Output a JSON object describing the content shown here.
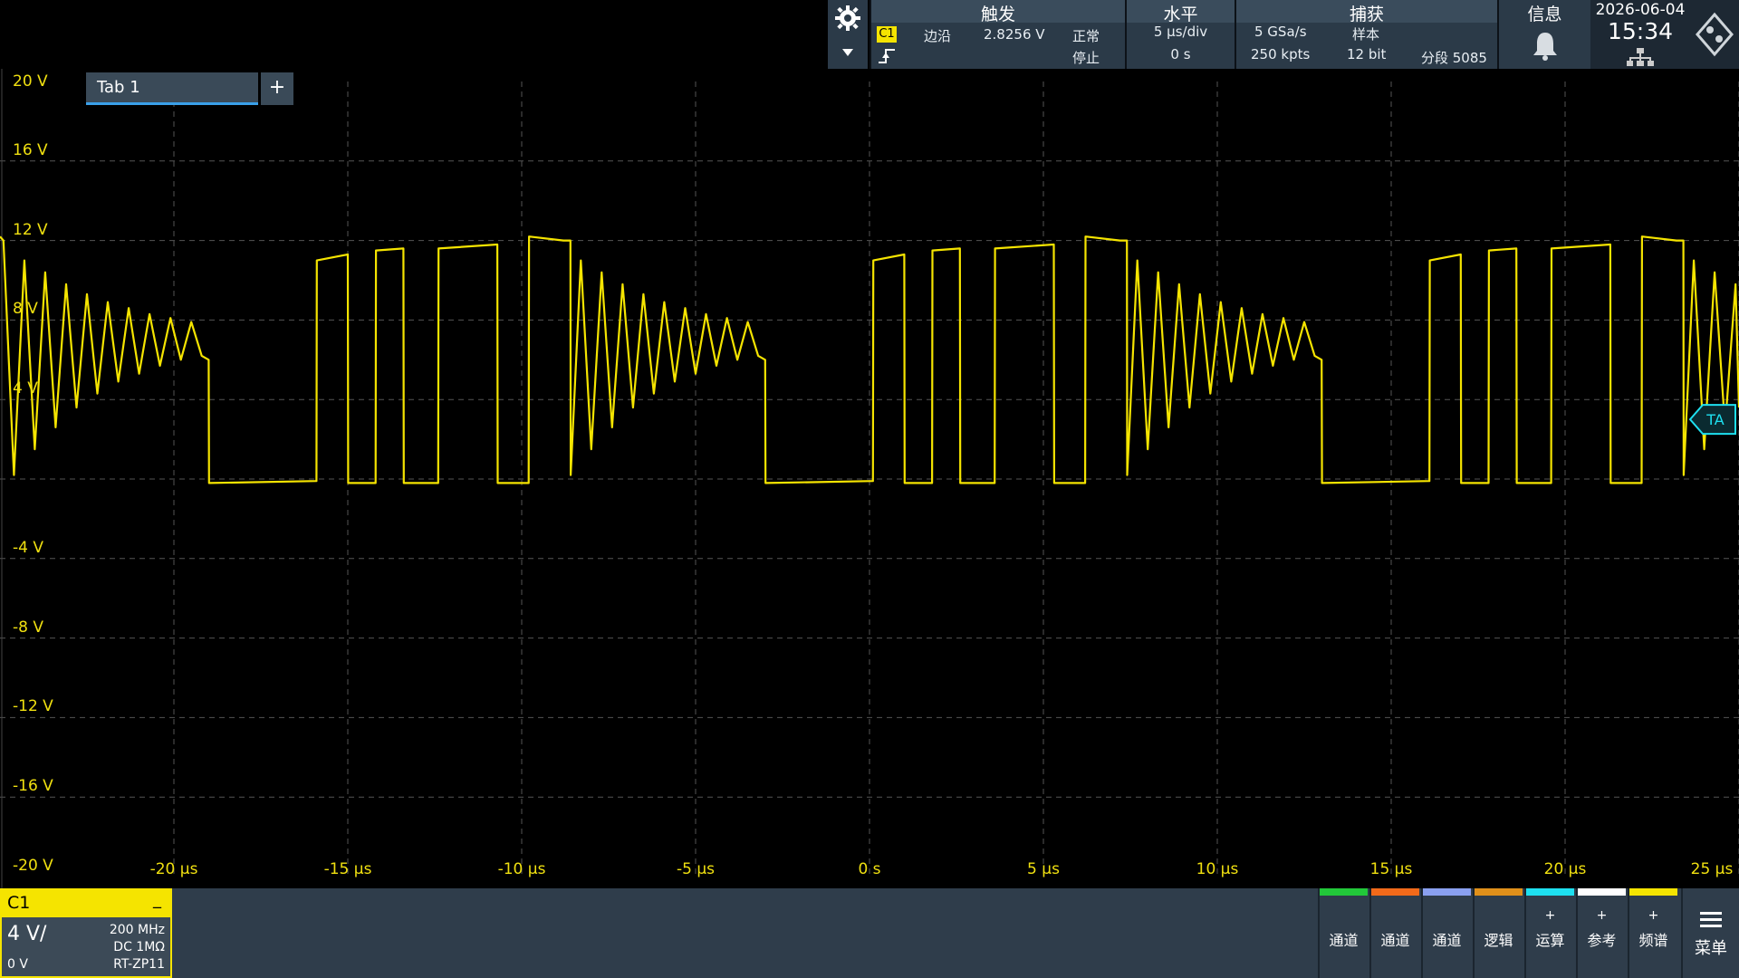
{
  "topbar": {
    "trigger": {
      "title": "触发",
      "channel": "C1",
      "type": "边沿",
      "level": "2.8256 V",
      "mode": "正常",
      "state": "停止"
    },
    "horizontal": {
      "title": "水平",
      "scale": "5 µs/div",
      "position": "0 s"
    },
    "acquisition": {
      "title": "捕获",
      "sample_rate": "5 GSa/s",
      "mode": "样本",
      "record_length": "250 kpts",
      "resolution": "12 bit",
      "segment": "分段 5085"
    },
    "info": {
      "title": "信息"
    },
    "date": "2026-06-04",
    "time": "15:34",
    "icons": {
      "settings": "gear-icon",
      "dropdown": "chevron-down-icon",
      "edge": "rising-edge-icon",
      "bell": "bell-icon",
      "network": "network-icon",
      "logo": "rs-logo"
    }
  },
  "tab": {
    "label": "Tab 1",
    "add": "+"
  },
  "chart_data": {
    "type": "line",
    "title": "",
    "xlabel": "",
    "ylabel": "",
    "y_ticks": [
      "20 V",
      "16 V",
      "12 V",
      "8 V",
      "4 V",
      "",
      "-4 V",
      "-8 V",
      "-12 V",
      "-16 V",
      "-20 V"
    ],
    "x_ticks": [
      "-20 µs",
      "-15 µs",
      "-10 µs",
      "-5 µs",
      "0 s",
      "5 µs",
      "10 µs",
      "15 µs",
      "20 µs",
      "25 µs"
    ],
    "xlim": [
      -25,
      25
    ],
    "ylim": [
      -20,
      20
    ],
    "grid": true,
    "series": [
      {
        "color": "#f5e400",
        "x": [
          -25,
          -24.9,
          -24.6,
          -24.3,
          -24.0,
          -23.7,
          -23.4,
          -23.1,
          -22.8,
          -22.5,
          -22.2,
          -21.9,
          -21.6,
          -21.3,
          -21.0,
          -20.7,
          -20.4,
          -20.1,
          -19.8,
          -19.5,
          -19.2,
          -19.0,
          -18.99,
          -15.9,
          -15.89,
          -15.0,
          -14.99,
          -14.2,
          -14.19,
          -13.4,
          -13.39,
          -12.4,
          -12.39,
          -10.7,
          -10.69,
          -9.8,
          -9.79,
          -8.8,
          -8.6,
          -8.59,
          -8.3,
          -8.0,
          -7.7,
          -7.4,
          -7.1,
          -6.8,
          -6.5,
          -6.2,
          -5.9,
          -5.6,
          -5.3,
          -5.0,
          -4.7,
          -4.4,
          -4.1,
          -3.8,
          -3.5,
          -3.2,
          -3.0,
          -2.99,
          0.1,
          0.11,
          1.0,
          1.01,
          1.8,
          1.81,
          2.6,
          2.61,
          3.6,
          3.61,
          5.3,
          5.31,
          6.2,
          6.21,
          7.2,
          7.4,
          7.41,
          7.7,
          8.0,
          8.3,
          8.6,
          8.9,
          9.2,
          9.5,
          9.8,
          10.1,
          10.4,
          10.7,
          11.0,
          11.3,
          11.6,
          11.9,
          12.2,
          12.5,
          12.8,
          13.0,
          13.01,
          16.1,
          16.11,
          17.0,
          17.01,
          17.8,
          17.81,
          18.6,
          18.61,
          19.6,
          19.61,
          21.3,
          21.31,
          22.2,
          22.21,
          23.2,
          23.4,
          23.41,
          23.7,
          24.0,
          24.3,
          24.6,
          24.9,
          25
        ],
        "y": [
          12.2,
          12.0,
          0.2,
          11.0,
          1.5,
          10.4,
          2.6,
          9.8,
          3.6,
          9.3,
          4.3,
          8.9,
          4.9,
          8.6,
          5.3,
          8.3,
          5.7,
          8.1,
          6.0,
          7.9,
          6.2,
          6.0,
          -0.2,
          -0.1,
          11.0,
          11.3,
          -0.2,
          -0.2,
          11.5,
          11.6,
          -0.2,
          -0.2,
          11.6,
          11.8,
          -0.2,
          -0.2,
          12.2,
          12.0,
          12.0,
          0.2,
          11.0,
          1.5,
          10.4,
          2.6,
          9.8,
          3.6,
          9.3,
          4.3,
          8.9,
          4.9,
          8.6,
          5.3,
          8.3,
          5.7,
          8.1,
          6.0,
          7.9,
          6.2,
          6.0,
          -0.2,
          -0.1,
          11.0,
          11.3,
          -0.2,
          -0.2,
          11.5,
          11.6,
          -0.2,
          -0.2,
          11.6,
          11.8,
          -0.2,
          -0.2,
          12.2,
          12.0,
          12.0,
          0.2,
          11.0,
          1.5,
          10.4,
          2.6,
          9.8,
          3.6,
          9.3,
          4.3,
          8.9,
          4.9,
          8.6,
          5.3,
          8.3,
          5.7,
          8.1,
          6.0,
          7.9,
          6.2,
          6.0,
          -0.2,
          -0.1,
          11.0,
          11.3,
          -0.2,
          -0.2,
          11.5,
          11.6,
          -0.2,
          -0.2,
          11.6,
          11.8,
          -0.2,
          -0.2,
          12.2,
          12.0,
          12.0,
          0.2,
          11.0,
          1.5,
          10.4,
          2.6,
          9.8,
          3.6
        ]
      }
    ],
    "markers": [
      {
        "label": "TA",
        "y": 3.0
      }
    ]
  },
  "channel": {
    "name": "C1",
    "minimize": "_",
    "scale": "4 V/",
    "offset": "0 V",
    "bandwidth": "200 MHz",
    "coupling": "DC 1MΩ",
    "probe": "RT-ZP11"
  },
  "bottom_buttons": [
    {
      "label": "通道",
      "plus": "",
      "color": "#22c83a"
    },
    {
      "label": "通道",
      "plus": "",
      "color": "#f26a1a"
    },
    {
      "label": "通道",
      "plus": "",
      "color": "#8aa0f0"
    },
    {
      "label": "逻辑",
      "plus": "",
      "color": "#e0901a"
    },
    {
      "label": "运算",
      "plus": "+",
      "color": "#1ee0f0"
    },
    {
      "label": "参考",
      "plus": "+",
      "color": "#ffffff"
    },
    {
      "label": "频谱",
      "plus": "+",
      "color": "#f5e400"
    }
  ],
  "menu": {
    "label": "菜单",
    "icon": "hamburger-icon"
  }
}
